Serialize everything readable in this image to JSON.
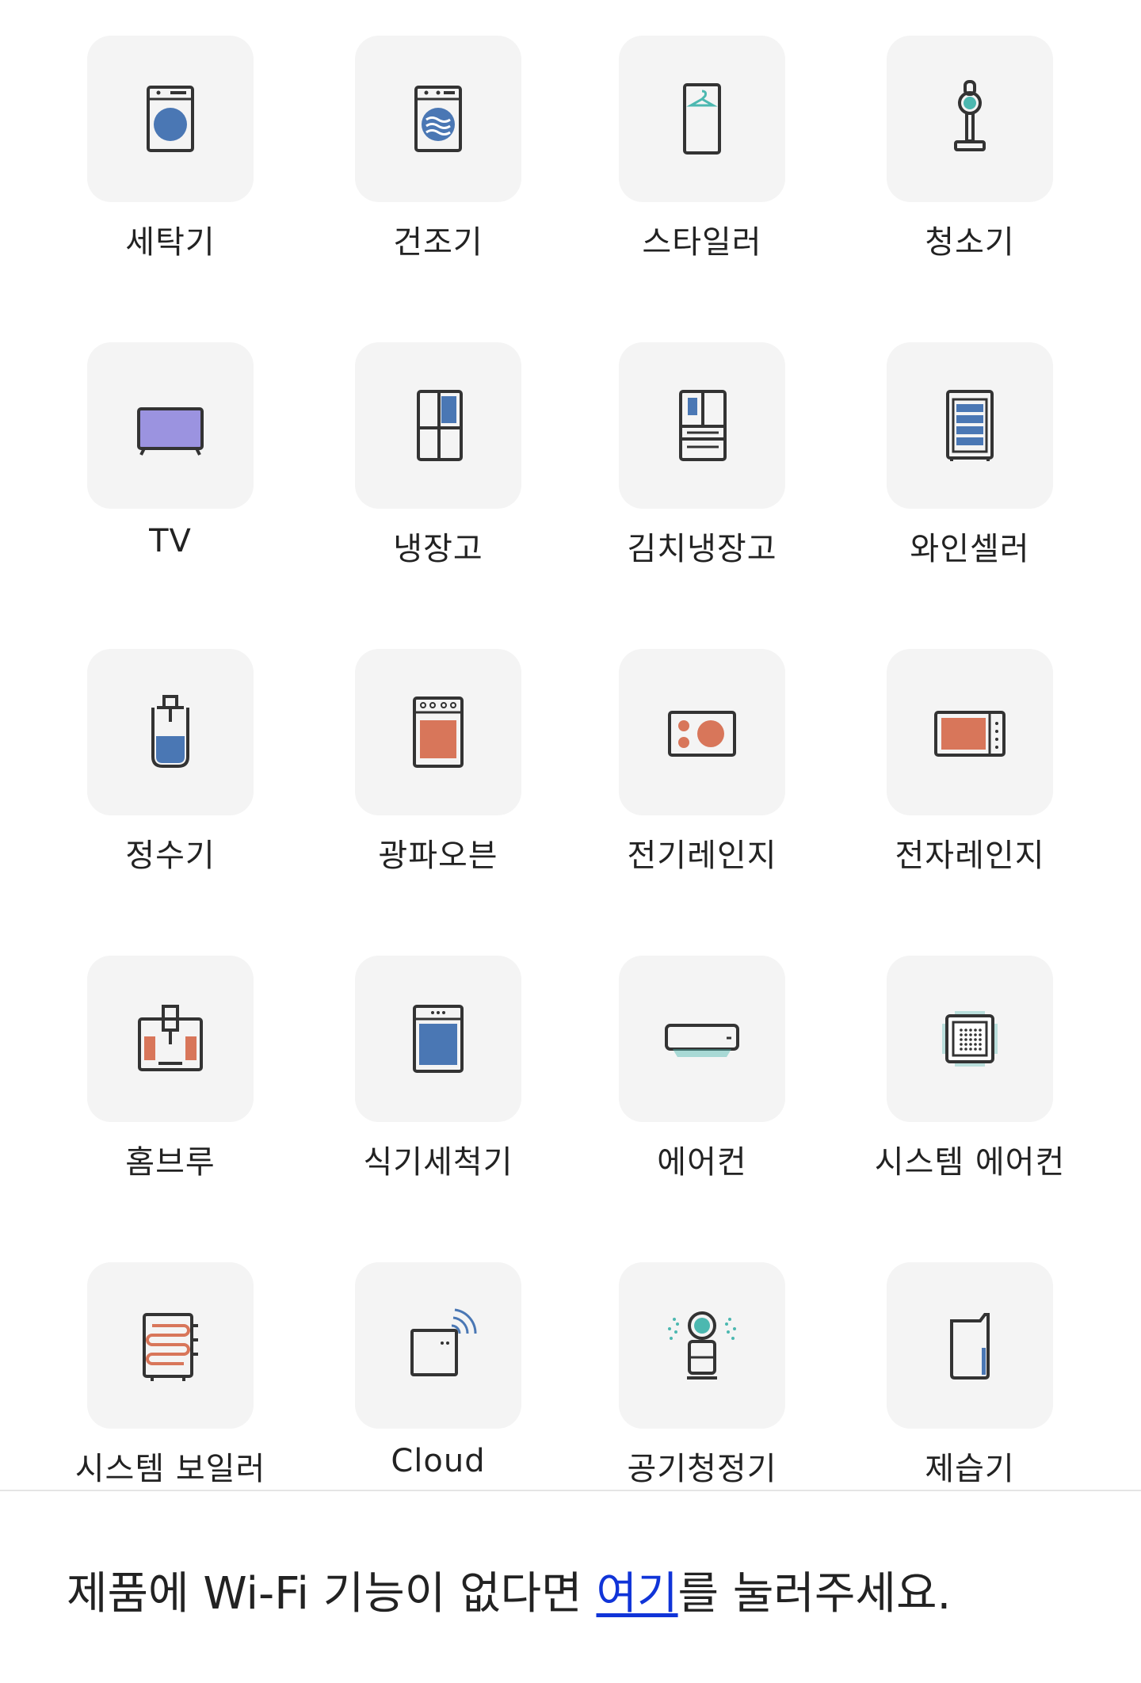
{
  "devices": [
    {
      "label": "세탁기",
      "icon": "washer-icon"
    },
    {
      "label": "건조기",
      "icon": "dryer-icon"
    },
    {
      "label": "스타일러",
      "icon": "styler-icon"
    },
    {
      "label": "청소기",
      "icon": "vacuum-icon"
    },
    {
      "label": "TV",
      "icon": "tv-icon"
    },
    {
      "label": "냉장고",
      "icon": "refrigerator-icon"
    },
    {
      "label": "김치냉장고",
      "icon": "kimchi-refrigerator-icon"
    },
    {
      "label": "와인셀러",
      "icon": "wine-cellar-icon"
    },
    {
      "label": "정수기",
      "icon": "water-purifier-icon"
    },
    {
      "label": "광파오븐",
      "icon": "oven-icon"
    },
    {
      "label": "전기레인지",
      "icon": "electric-range-icon"
    },
    {
      "label": "전자레인지",
      "icon": "microwave-icon"
    },
    {
      "label": "홈브루",
      "icon": "homebrew-icon"
    },
    {
      "label": "식기세척기",
      "icon": "dishwasher-icon"
    },
    {
      "label": "에어컨",
      "icon": "air-conditioner-icon"
    },
    {
      "label": "시스템 에어컨",
      "icon": "system-air-conditioner-icon"
    },
    {
      "label": "시스템 보일러",
      "icon": "system-boiler-icon"
    },
    {
      "label": "Cloud",
      "icon": "cloud-device-icon"
    },
    {
      "label": "공기청정기",
      "icon": "air-purifier-icon"
    },
    {
      "label": "제습기",
      "icon": "dehumidifier-icon"
    }
  ],
  "footer": {
    "prefix": "제품에 Wi-Fi 기능이 없다면 ",
    "link": "여기",
    "suffix": "를 눌러주세요."
  },
  "colors": {
    "tile_bg": "#f4f4f4",
    "line": "#333333",
    "blue": "#4a77b4",
    "orange": "#d8765a",
    "teal": "#4cb8b0",
    "purple": "#9b93e0",
    "link": "#1034d8"
  }
}
